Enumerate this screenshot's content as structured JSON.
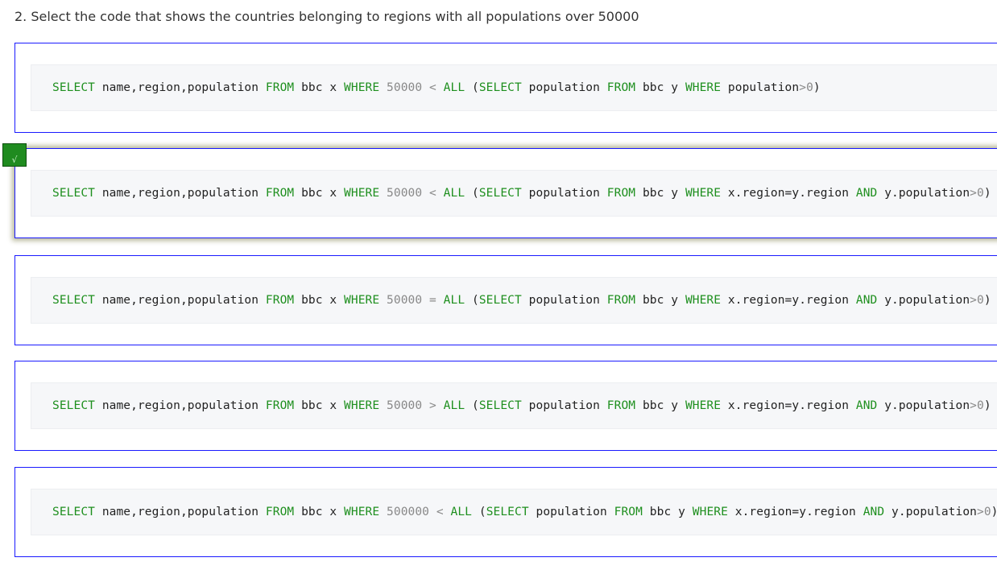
{
  "question": "2. Select the code that shows the countries belonging to regions with all populations over 50000",
  "check_glyph": "√",
  "options": [
    {
      "selected": false,
      "tokens": [
        {
          "t": "SELECT",
          "c": "kw"
        },
        {
          "t": " name,region,population ",
          "c": "tok"
        },
        {
          "t": "FROM",
          "c": "kw"
        },
        {
          "t": " bbc x ",
          "c": "tok"
        },
        {
          "t": "WHERE",
          "c": "kw"
        },
        {
          "t": " 50000 < ",
          "c": "num"
        },
        {
          "t": "ALL",
          "c": "kw"
        },
        {
          "t": " (",
          "c": "tok"
        },
        {
          "t": "SELECT",
          "c": "kw"
        },
        {
          "t": " population ",
          "c": "tok"
        },
        {
          "t": "FROM",
          "c": "kw"
        },
        {
          "t": " bbc y ",
          "c": "tok"
        },
        {
          "t": "WHERE",
          "c": "kw"
        },
        {
          "t": " population",
          "c": "tok"
        },
        {
          "t": ">0",
          "c": "num"
        },
        {
          "t": ")",
          "c": "tok"
        }
      ]
    },
    {
      "selected": true,
      "tokens": [
        {
          "t": "SELECT",
          "c": "kw"
        },
        {
          "t": " name,region,population ",
          "c": "tok"
        },
        {
          "t": "FROM",
          "c": "kw"
        },
        {
          "t": " bbc x ",
          "c": "tok"
        },
        {
          "t": "WHERE",
          "c": "kw"
        },
        {
          "t": " 50000 < ",
          "c": "num"
        },
        {
          "t": "ALL",
          "c": "kw"
        },
        {
          "t": " (",
          "c": "tok"
        },
        {
          "t": "SELECT",
          "c": "kw"
        },
        {
          "t": " population ",
          "c": "tok"
        },
        {
          "t": "FROM",
          "c": "kw"
        },
        {
          "t": " bbc y ",
          "c": "tok"
        },
        {
          "t": "WHERE",
          "c": "kw"
        },
        {
          "t": " x.region=y.region ",
          "c": "tok"
        },
        {
          "t": "AND",
          "c": "kw"
        },
        {
          "t": " y.population",
          "c": "tok"
        },
        {
          "t": ">0",
          "c": "num"
        },
        {
          "t": ")",
          "c": "tok"
        }
      ]
    },
    {
      "selected": false,
      "tokens": [
        {
          "t": "SELECT",
          "c": "kw"
        },
        {
          "t": " name,region,population ",
          "c": "tok"
        },
        {
          "t": "FROM",
          "c": "kw"
        },
        {
          "t": " bbc x ",
          "c": "tok"
        },
        {
          "t": "WHERE",
          "c": "kw"
        },
        {
          "t": " 50000 = ",
          "c": "num"
        },
        {
          "t": "ALL",
          "c": "kw"
        },
        {
          "t": " (",
          "c": "tok"
        },
        {
          "t": "SELECT",
          "c": "kw"
        },
        {
          "t": " population ",
          "c": "tok"
        },
        {
          "t": "FROM",
          "c": "kw"
        },
        {
          "t": " bbc y ",
          "c": "tok"
        },
        {
          "t": "WHERE",
          "c": "kw"
        },
        {
          "t": " x.region=y.region ",
          "c": "tok"
        },
        {
          "t": "AND",
          "c": "kw"
        },
        {
          "t": " y.population",
          "c": "tok"
        },
        {
          "t": ">0",
          "c": "num"
        },
        {
          "t": ")",
          "c": "tok"
        }
      ]
    },
    {
      "selected": false,
      "tokens": [
        {
          "t": "SELECT",
          "c": "kw"
        },
        {
          "t": " name,region,population ",
          "c": "tok"
        },
        {
          "t": "FROM",
          "c": "kw"
        },
        {
          "t": " bbc x ",
          "c": "tok"
        },
        {
          "t": "WHERE",
          "c": "kw"
        },
        {
          "t": " 50000 > ",
          "c": "num"
        },
        {
          "t": "ALL",
          "c": "kw"
        },
        {
          "t": " (",
          "c": "tok"
        },
        {
          "t": "SELECT",
          "c": "kw"
        },
        {
          "t": " population ",
          "c": "tok"
        },
        {
          "t": "FROM",
          "c": "kw"
        },
        {
          "t": " bbc y ",
          "c": "tok"
        },
        {
          "t": "WHERE",
          "c": "kw"
        },
        {
          "t": " x.region=y.region ",
          "c": "tok"
        },
        {
          "t": "AND",
          "c": "kw"
        },
        {
          "t": " y.population",
          "c": "tok"
        },
        {
          "t": ">0",
          "c": "num"
        },
        {
          "t": ")",
          "c": "tok"
        }
      ]
    },
    {
      "selected": false,
      "tokens": [
        {
          "t": "SELECT",
          "c": "kw"
        },
        {
          "t": " name,region,population ",
          "c": "tok"
        },
        {
          "t": "FROM",
          "c": "kw"
        },
        {
          "t": " bbc x ",
          "c": "tok"
        },
        {
          "t": "WHERE",
          "c": "kw"
        },
        {
          "t": " 500000 < ",
          "c": "num"
        },
        {
          "t": "ALL",
          "c": "kw"
        },
        {
          "t": " (",
          "c": "tok"
        },
        {
          "t": "SELECT",
          "c": "kw"
        },
        {
          "t": " population ",
          "c": "tok"
        },
        {
          "t": "FROM",
          "c": "kw"
        },
        {
          "t": " bbc y ",
          "c": "tok"
        },
        {
          "t": "WHERE",
          "c": "kw"
        },
        {
          "t": " x.region=y.region ",
          "c": "tok"
        },
        {
          "t": "AND",
          "c": "kw"
        },
        {
          "t": " y.population",
          "c": "tok"
        },
        {
          "t": ">0",
          "c": "num"
        },
        {
          "t": ")",
          "c": "tok"
        }
      ]
    }
  ],
  "colors": {
    "option_border": "#1a1aff",
    "keyword": "#1e8f1e",
    "number": "#888888",
    "check_bg": "#1f8b1f"
  }
}
